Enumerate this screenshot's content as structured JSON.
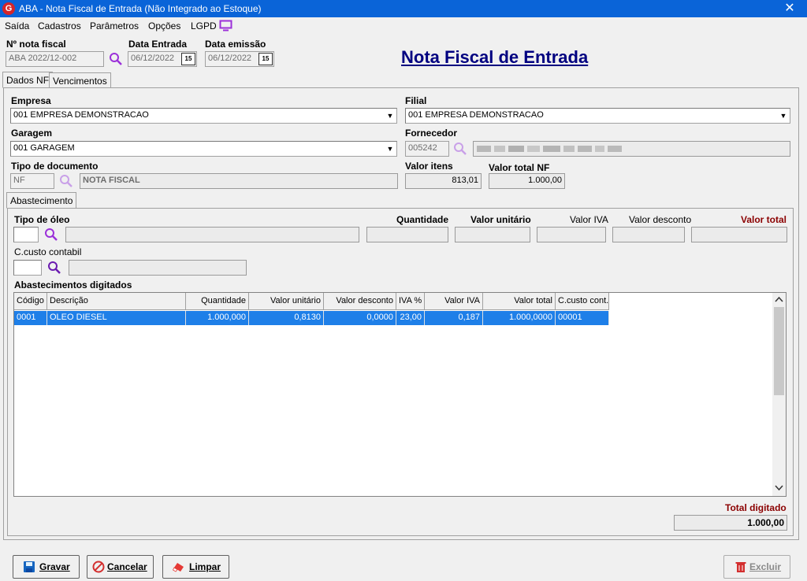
{
  "window": {
    "logo": "G",
    "title": "ABA - Nota Fiscal de Entrada (Não Integrado ao Estoque)",
    "close": "✕"
  },
  "menu": [
    "Saída",
    "Cadastros",
    "Parâmetros",
    "Opções",
    "LGPD"
  ],
  "header": {
    "nota_label": "Nº nota fiscal",
    "nota_value": "ABA 2022/12-002",
    "data_entrada_label": "Data Entrada",
    "data_entrada_value": "06/12/2022",
    "data_emissao_label": "Data emissão",
    "data_emissao_value": "06/12/2022",
    "calendar_text": "15",
    "page_title": "Nota Fiscal de Entrada"
  },
  "tabs": [
    "Dados NF",
    "Vencimentos"
  ],
  "form": {
    "empresa_label": "Empresa",
    "empresa_value": "001 EMPRESA DEMONSTRACAO",
    "filial_label": "Filial",
    "filial_value": "001 EMPRESA DEMONSTRACAO",
    "garagem_label": "Garagem",
    "garagem_value": "001 GARAGEM",
    "fornecedor_label": "Fornecedor",
    "fornecedor_code": "005242",
    "tipo_doc_label": "Tipo de documento",
    "tipo_doc_code": "NF",
    "tipo_doc_desc": "NOTA FISCAL",
    "valor_itens_label": "Valor itens",
    "valor_itens_value": "813,01",
    "valor_total_label": "Valor total NF",
    "valor_total_value": "1.000,00"
  },
  "subtab": "Abastecimento",
  "abastecimento": {
    "tipo_oleo_label": "Tipo de óleo",
    "quantidade_label": "Quantidade",
    "valor_unitario_label": "Valor unitário",
    "valor_iva_label": "Valor IVA",
    "valor_desconto_label": "Valor desconto",
    "valor_total_label": "Valor total",
    "ccusto_label": "C.custo contabil",
    "digitados_label": "Abastecimentos digitados"
  },
  "grid": {
    "columns": [
      "Código",
      "Descrição",
      "Quantidade",
      "Valor unitário",
      "Valor desconto",
      "IVA %",
      "Valor IVA",
      "Valor total",
      "C.custo cont."
    ],
    "rows": [
      [
        "0001",
        "OLEO DIESEL",
        "1.000,000",
        "0,8130",
        "0,0000",
        "23,00",
        "0,187",
        "1.000,0000",
        "00001"
      ]
    ]
  },
  "totals": {
    "label": "Total digitado",
    "value": "1.000,00"
  },
  "buttons": {
    "gravar": "Gravar",
    "cancelar": "Cancelar",
    "limpar": "Limpar",
    "excluir": "Excluir"
  },
  "colors": {
    "titlebar": "#0a64d8",
    "selection": "#1e7fe8",
    "accent_red": "#8b0000",
    "title_blue": "#000080",
    "magnifier": "#9b30d9"
  }
}
